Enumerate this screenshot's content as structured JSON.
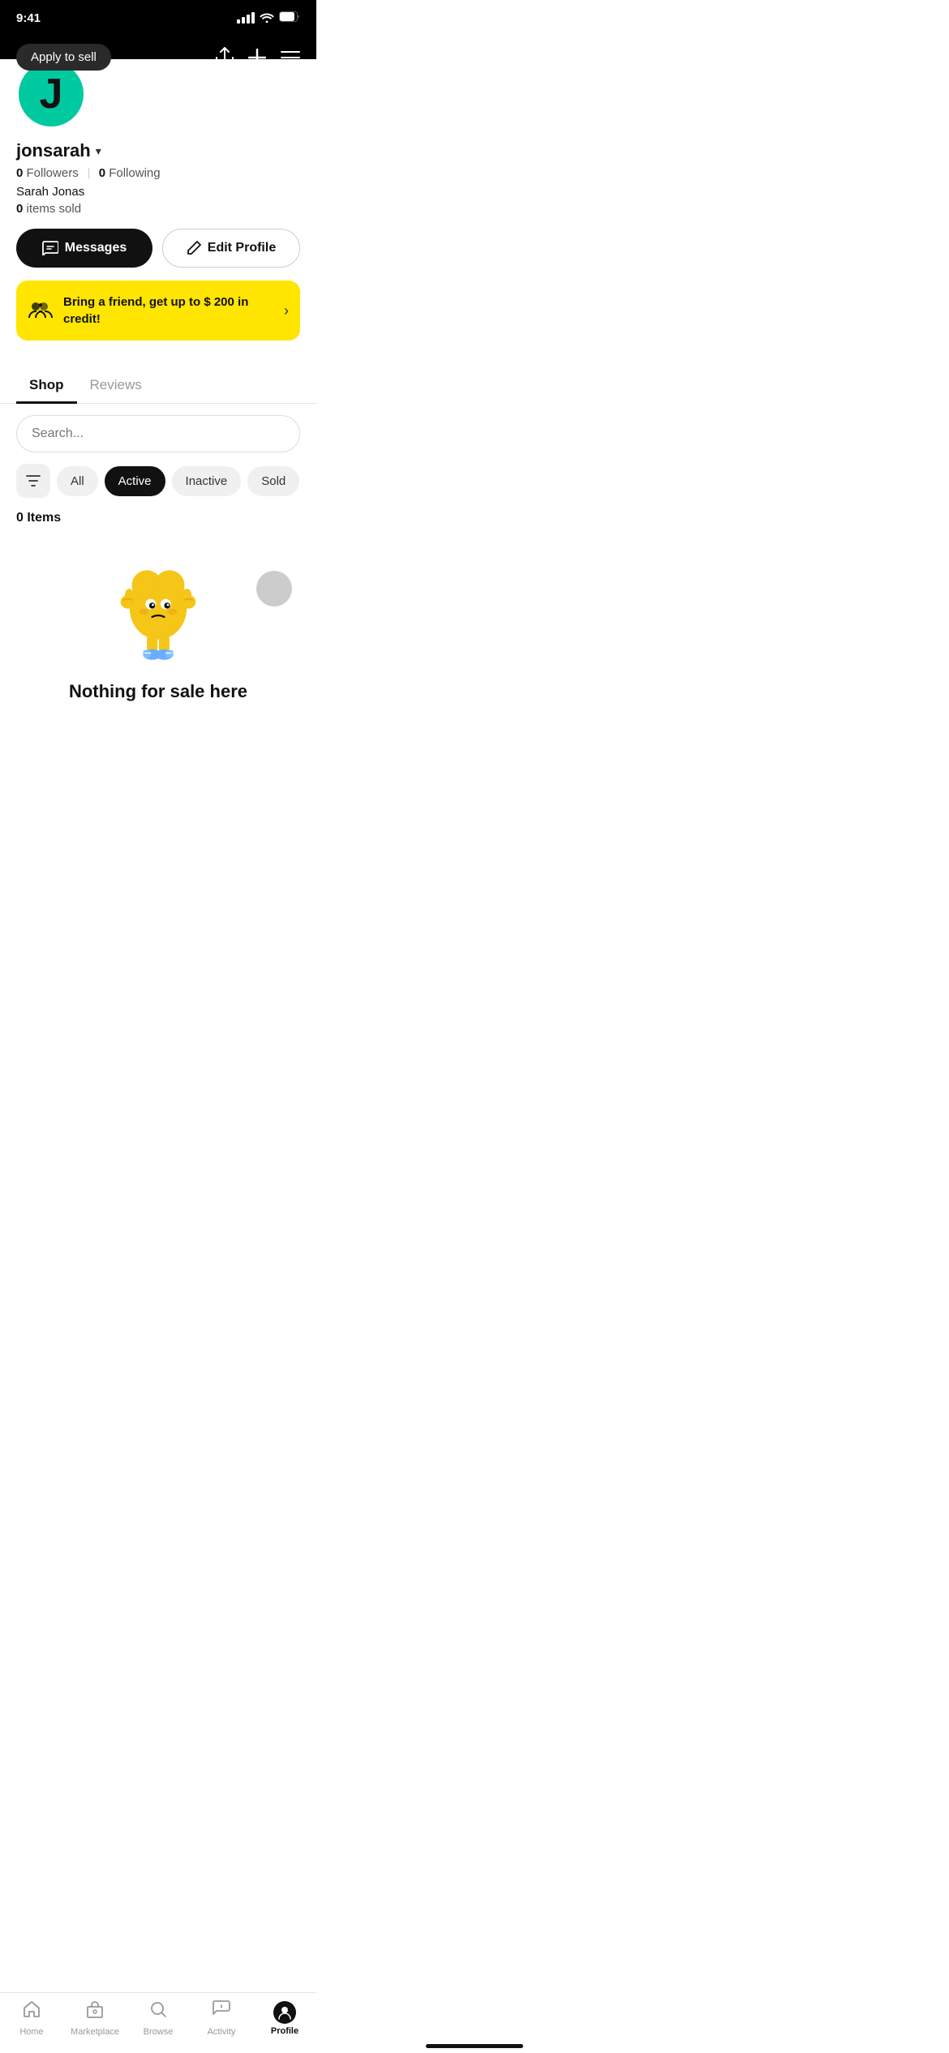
{
  "statusBar": {
    "time": "9:41"
  },
  "header": {
    "applyToSellLabel": "Apply to sell"
  },
  "profile": {
    "avatarInitial": "J",
    "username": "jonsarah",
    "followersCount": "0",
    "followersLabel": "Followers",
    "followingCount": "0",
    "followingLabel": "Following",
    "fullName": "Sarah Jonas",
    "itemsSoldCount": "0",
    "itemsSoldLabel": "items sold"
  },
  "buttons": {
    "messagesLabel": "Messages",
    "editProfileLabel": "Edit Profile"
  },
  "referralBanner": {
    "text": "Bring a friend, get up to $ 200 in credit!"
  },
  "tabs": [
    {
      "label": "Shop",
      "active": true
    },
    {
      "label": "Reviews",
      "active": false
    }
  ],
  "search": {
    "placeholder": "Search..."
  },
  "filters": [
    {
      "label": "All",
      "active": false
    },
    {
      "label": "Active",
      "active": true
    },
    {
      "label": "Inactive",
      "active": false
    },
    {
      "label": "Sold",
      "active": false
    }
  ],
  "itemsCount": "0 Items",
  "emptyState": {
    "title": "Nothing for sale here"
  },
  "bottomNav": [
    {
      "label": "Home",
      "active": false,
      "icon": "🏠"
    },
    {
      "label": "Marketplace",
      "active": false,
      "icon": "🏪"
    },
    {
      "label": "Browse",
      "active": false,
      "icon": "🔍"
    },
    {
      "label": "Activity",
      "active": false,
      "icon": "💬"
    },
    {
      "label": "Profile",
      "active": true,
      "icon": "👤"
    }
  ]
}
